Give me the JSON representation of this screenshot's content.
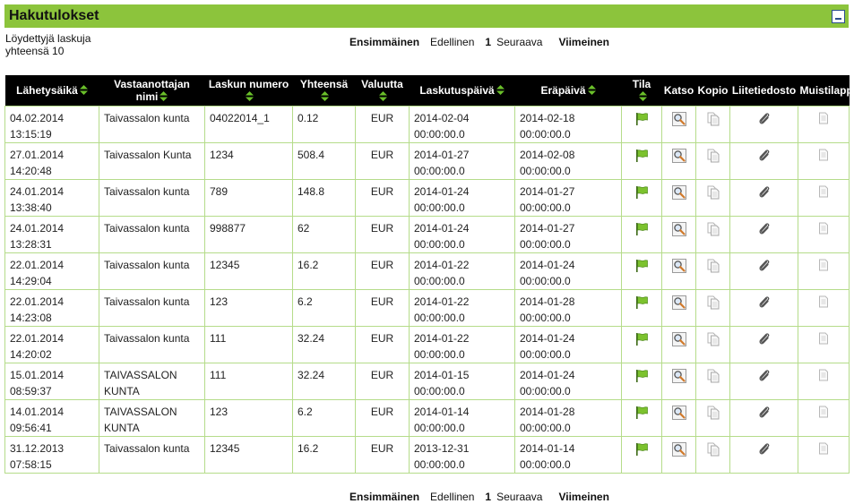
{
  "header": {
    "title": "Hakutulokset"
  },
  "summary": {
    "line1": "Löydettyjä laskuja",
    "line2": "yhteensä 10"
  },
  "pager": {
    "first": "Ensimmäinen",
    "prev": "Edellinen",
    "current": "1",
    "next": "Seuraava",
    "last": "Viimeinen"
  },
  "columns": {
    "sent": "Lähetysäikä",
    "recipient_l1": "Vastaanottajan",
    "recipient_l2": "nimi",
    "invoice_number": "Laskun numero",
    "total": "Yhteensä",
    "currency": "Valuutta",
    "invoice_date": "Laskutuspäivä",
    "due_date": "Eräpäivä",
    "status": "Tila",
    "view": "Katso",
    "copy": "Kopio",
    "attachment": "Liitetiedosto",
    "note": "Muistilappu"
  },
  "colors": {
    "header_bar": "#8cc43c",
    "row_border": "#b5dc8a",
    "flag": "#7cc22e",
    "sort_arrow": "#6abf2a"
  },
  "icons": {
    "status": "green-flag-icon",
    "view": "magnifier-icon",
    "copy": "document-copy-icon",
    "attachment": "paperclip-icon",
    "note": "note-icon"
  },
  "rows": [
    {
      "sent_date": "04.02.2014",
      "sent_time": "13:15:19",
      "recipient_l1": "Taivassalon kunta",
      "recipient_l2": "",
      "number": "04022014_1",
      "total": "0.12",
      "currency": "EUR",
      "inv_date": "2014-02-04",
      "inv_time": "00:00:00.0",
      "due_date": "2014-02-18",
      "due_time": "00:00:00.0"
    },
    {
      "sent_date": "27.01.2014",
      "sent_time": "14:20:48",
      "recipient_l1": "Taivassalon Kunta",
      "recipient_l2": "",
      "number": "1234",
      "total": "508.4",
      "currency": "EUR",
      "inv_date": "2014-01-27",
      "inv_time": "00:00:00.0",
      "due_date": "2014-02-08",
      "due_time": "00:00:00.0"
    },
    {
      "sent_date": "24.01.2014",
      "sent_time": "13:38:40",
      "recipient_l1": "Taivassalon kunta",
      "recipient_l2": "",
      "number": "789",
      "total": "148.8",
      "currency": "EUR",
      "inv_date": "2014-01-24",
      "inv_time": "00:00:00.0",
      "due_date": "2014-01-27",
      "due_time": "00:00:00.0"
    },
    {
      "sent_date": "24.01.2014",
      "sent_time": "13:28:31",
      "recipient_l1": "Taivassalon kunta",
      "recipient_l2": "",
      "number": "998877",
      "total": "62",
      "currency": "EUR",
      "inv_date": "2014-01-24",
      "inv_time": "00:00:00.0",
      "due_date": "2014-01-27",
      "due_time": "00:00:00.0"
    },
    {
      "sent_date": "22.01.2014",
      "sent_time": "14:29:04",
      "recipient_l1": "Taivassalon kunta",
      "recipient_l2": "",
      "number": "12345",
      "total": "16.2",
      "currency": "EUR",
      "inv_date": "2014-01-22",
      "inv_time": "00:00:00.0",
      "due_date": "2014-01-24",
      "due_time": "00:00:00.0"
    },
    {
      "sent_date": "22.01.2014",
      "sent_time": "14:23:08",
      "recipient_l1": "Taivassalon kunta",
      "recipient_l2": "",
      "number": "123",
      "total": "6.2",
      "currency": "EUR",
      "inv_date": "2014-01-22",
      "inv_time": "00:00:00.0",
      "due_date": "2014-01-28",
      "due_time": "00:00:00.0"
    },
    {
      "sent_date": "22.01.2014",
      "sent_time": "14:20:02",
      "recipient_l1": "Taivassalon kunta",
      "recipient_l2": "",
      "number": "111",
      "total": "32.24",
      "currency": "EUR",
      "inv_date": "2014-01-22",
      "inv_time": "00:00:00.0",
      "due_date": "2014-01-24",
      "due_time": "00:00:00.0"
    },
    {
      "sent_date": "15.01.2014",
      "sent_time": "08:59:37",
      "recipient_l1": "TAIVASSALON",
      "recipient_l2": "KUNTA",
      "number": "111",
      "total": "32.24",
      "currency": "EUR",
      "inv_date": "2014-01-15",
      "inv_time": "00:00:00.0",
      "due_date": "2014-01-24",
      "due_time": "00:00:00.0"
    },
    {
      "sent_date": "14.01.2014",
      "sent_time": "09:56:41",
      "recipient_l1": "TAIVASSALON",
      "recipient_l2": "KUNTA",
      "number": "123",
      "total": "6.2",
      "currency": "EUR",
      "inv_date": "2014-01-14",
      "inv_time": "00:00:00.0",
      "due_date": "2014-01-28",
      "due_time": "00:00:00.0"
    },
    {
      "sent_date": "31.12.2013",
      "sent_time": "07:58:15",
      "recipient_l1": "Taivassalon kunta",
      "recipient_l2": "",
      "number": "12345",
      "total": "16.2",
      "currency": "EUR",
      "inv_date": "2013-12-31",
      "inv_time": "00:00:00.0",
      "due_date": "2014-01-14",
      "due_time": "00:00:00.0"
    }
  ]
}
